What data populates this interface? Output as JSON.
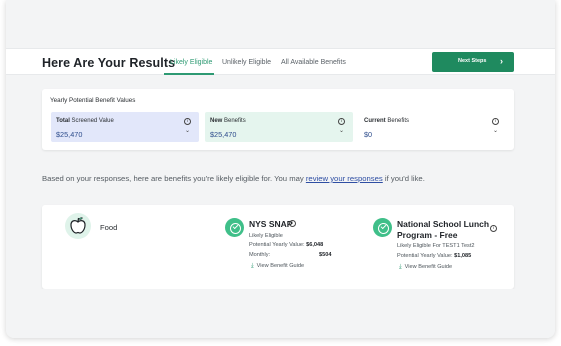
{
  "header": {
    "title": "Here Are Your Results",
    "tabs": [
      {
        "label": "Likely Eligible",
        "active": true
      },
      {
        "label": "Unlikely Eligible",
        "active": false
      },
      {
        "label": "All Available Benefits",
        "active": false
      }
    ],
    "next_button": "Next Steps",
    "accent_color": "#1f8a5f"
  },
  "yearly": {
    "title": "Yearly Potential Benefit Values",
    "boxes": [
      {
        "bold": "Total",
        "rest": " Screened Value",
        "amount": "$25,470"
      },
      {
        "bold": "New",
        "rest": " Benefits",
        "amount": "$25,470"
      },
      {
        "bold": "Current",
        "rest": " Benefits",
        "amount": "$0"
      }
    ]
  },
  "summary": {
    "prefix": "Based on your responses, here are benefits you're likely eligible for. You may ",
    "link": "review your responses",
    "suffix": " if you'd like."
  },
  "results": {
    "category": "Food",
    "category_icon": "apple-icon",
    "benefits": [
      {
        "title": "NYS SNAP",
        "status": "Likely Eligible",
        "yearly_label": "Potential Yearly Value:",
        "yearly_value": "$6,048",
        "monthly_label": "Monthly:",
        "monthly_value": "$504",
        "guide": "View Benefit Guide"
      },
      {
        "title_line1": "National School Lunch",
        "title_line2": "Program - Free",
        "status": "Likely Eligible For TEST1 Test2",
        "yearly_label": "Potential Yearly Value:",
        "yearly_value": "$1,085",
        "guide": "View Benefit Guide"
      }
    ]
  }
}
